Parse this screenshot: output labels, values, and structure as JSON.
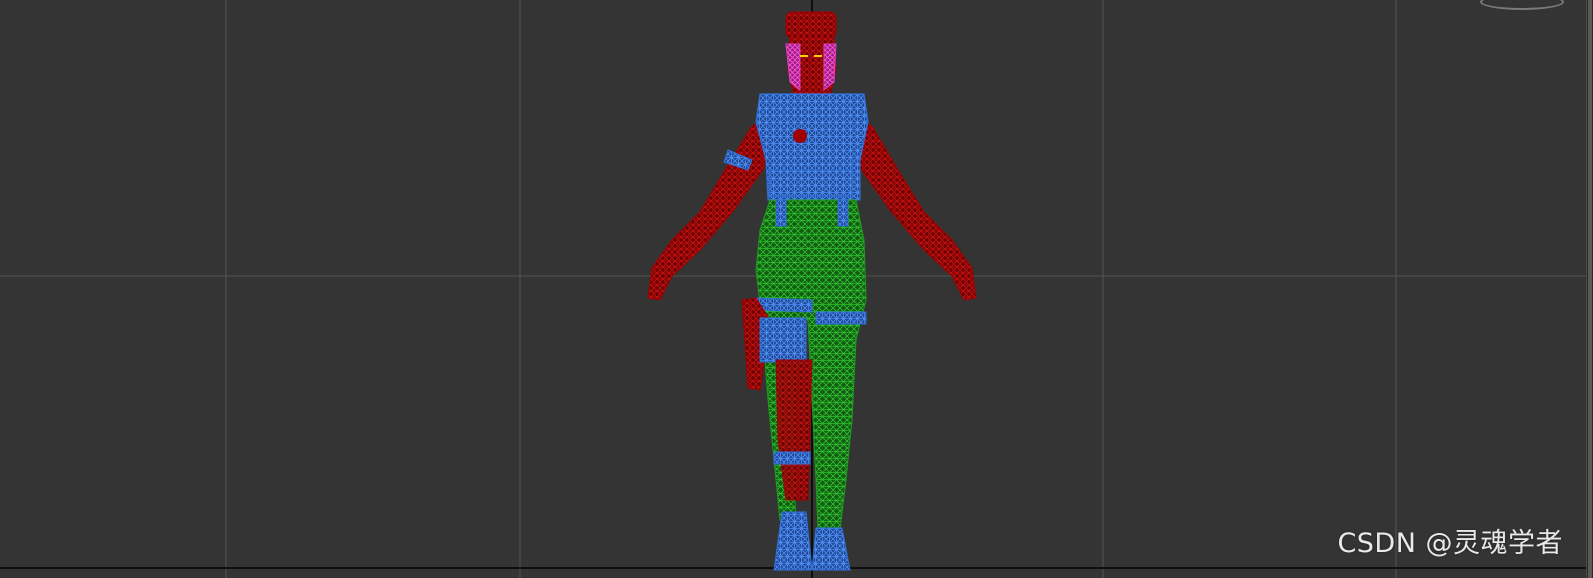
{
  "watermark": "CSDN @灵魂学者",
  "colors": {
    "viewport_bg": "#343434",
    "grid_line": "#555555",
    "axis_line": "#111111",
    "mesh_red": "#a00000",
    "mesh_blue": "#2f6fd8",
    "mesh_green": "#1f9a1f",
    "mesh_pink": "#e040c0"
  },
  "icons": [
    "view-gizmo-icon",
    "viewport-resize-handle"
  ]
}
